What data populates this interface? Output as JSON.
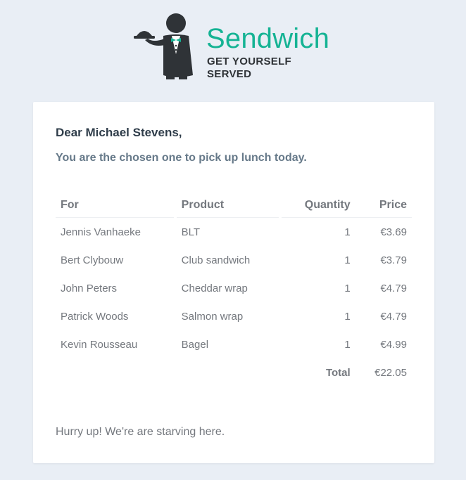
{
  "brand": {
    "name": "Sendwich",
    "tagline": "GET YOURSELF SERVED",
    "accent_color": "#15b394",
    "logo_icon": "waiter-icon"
  },
  "email": {
    "greeting": "Dear Michael Stevens,",
    "intro": "You are the chosen one to pick up lunch today.",
    "footer": "Hurry up! We're are starving here."
  },
  "table": {
    "headers": {
      "for": "For",
      "product": "Product",
      "quantity": "Quantity",
      "price": "Price"
    },
    "rows": [
      {
        "for": "Jennis Vanhaeke",
        "product": "BLT",
        "quantity": "1",
        "price": "€3.69"
      },
      {
        "for": "Bert Clybouw",
        "product": "Club sandwich",
        "quantity": "1",
        "price": "€3.79"
      },
      {
        "for": "John Peters",
        "product": "Cheddar wrap",
        "quantity": "1",
        "price": "€4.79"
      },
      {
        "for": "Patrick Woods",
        "product": "Salmon wrap",
        "quantity": "1",
        "price": "€4.79"
      },
      {
        "for": "Kevin Rousseau",
        "product": "Bagel",
        "quantity": "1",
        "price": "€4.99"
      }
    ],
    "total_label": "Total",
    "total_value": "€22.05"
  }
}
